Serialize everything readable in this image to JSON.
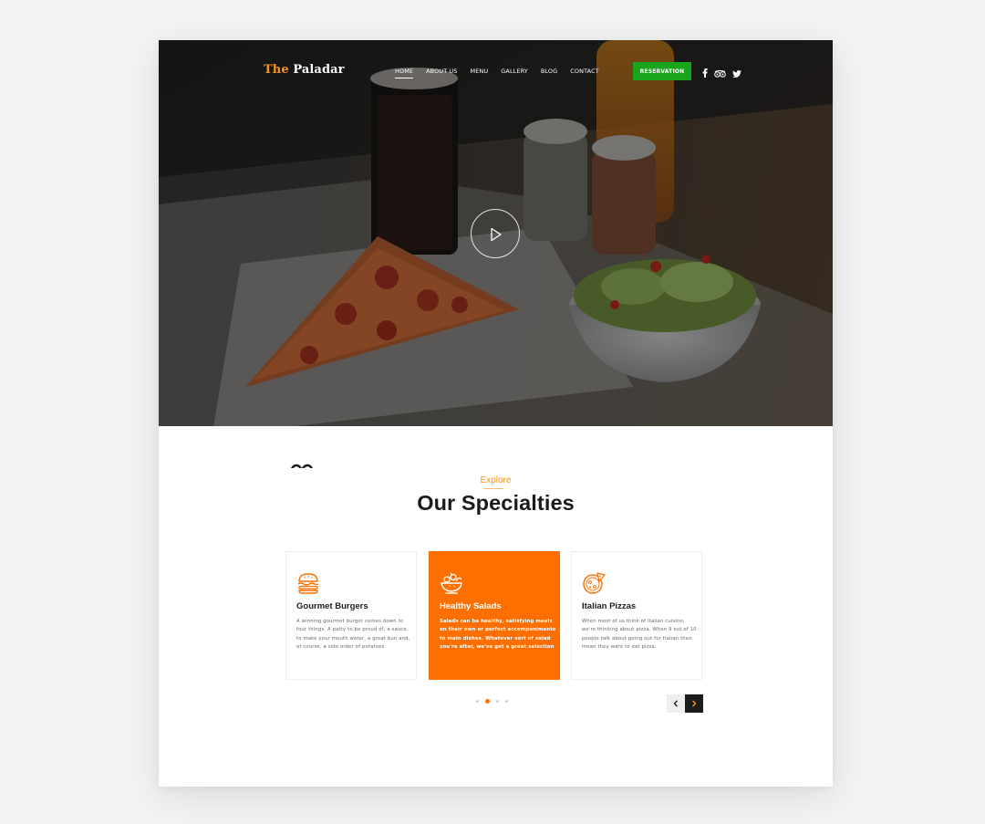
{
  "header": {
    "logo_prefix": "The",
    "logo_name": "Paladar",
    "nav": [
      "HOME",
      "ABOUT US",
      "MENU",
      "GALLERY",
      "BLOG",
      "CONTACT"
    ],
    "reservation_label": "RESERVATION",
    "social_icons": [
      "facebook-icon",
      "tripadvisor-icon",
      "twitter-icon"
    ]
  },
  "hero": {
    "play_icon": "play-icon"
  },
  "specialties": {
    "eyebrow": "Explore",
    "title": "Our Specialties",
    "cards": [
      {
        "icon": "burger-icon",
        "title": "Gourmet Burgers",
        "text": "A winning gourmet burger comes down to four things. A patty to be proud of, a sauce to make your mouth water, a great bun and, of course, a side order of potatoes"
      },
      {
        "icon": "salad-icon",
        "title": "Healthy Salads",
        "text": "Salads can be healthy, satisfying meals on their own or perfect accompaniments to main dishes. Whatever sort of salad you're after, we've got a great selection"
      },
      {
        "icon": "pizza-icon",
        "title": "Italian Pizzas",
        "text": "When most of us think of Italian cuisine, we're thinking about pizza. When 9 out of 10 people talk about going out for Italian then mean they want to eat pizza."
      }
    ],
    "pagination_count": 4,
    "pagination_active": 1
  },
  "colors": {
    "accent": "#ff6f00",
    "logo_accent": "#f7941d",
    "reservation": "#18a51c",
    "dark": "#1c1c1c"
  }
}
